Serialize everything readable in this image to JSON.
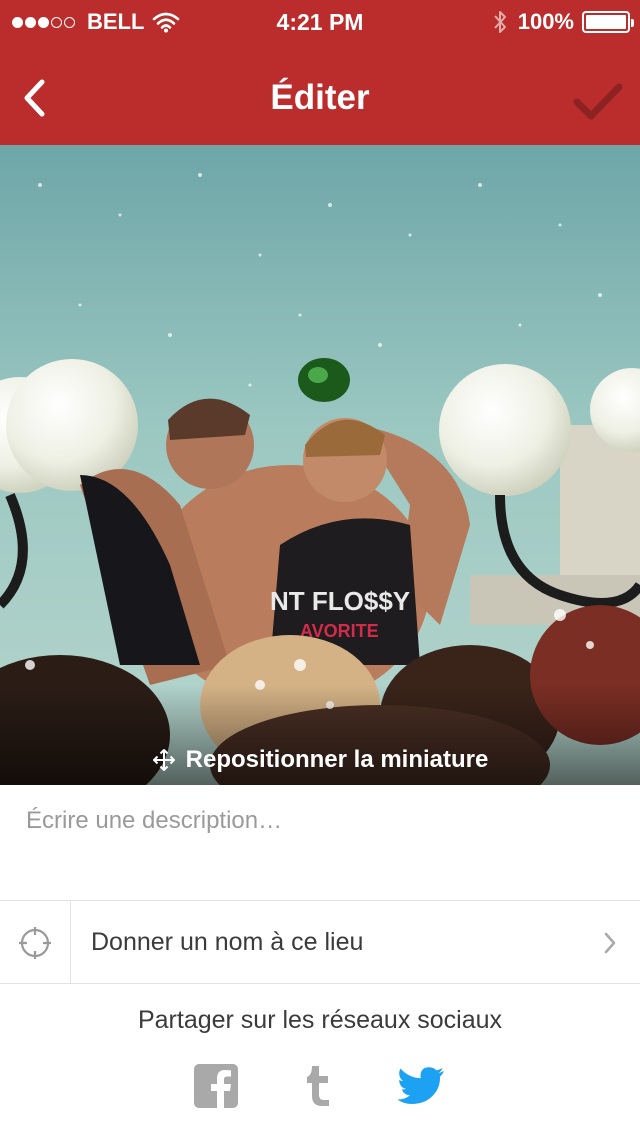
{
  "status_bar": {
    "carrier": "BELL",
    "time": "4:21 PM",
    "battery": "100%",
    "signal_bars_filled": 3,
    "signal_bars_total": 5,
    "battery_level": 1.0
  },
  "nav": {
    "title": "Éditer",
    "back_icon": "chevron-left-icon",
    "confirm_icon": "checkmark-icon"
  },
  "photo": {
    "reposition_label": "Repositionner la miniature",
    "reposition_icon": "move-arrows-icon"
  },
  "description": {
    "placeholder": "Écrire une description…",
    "value": ""
  },
  "location": {
    "label": "Donner un nom à ce lieu",
    "icon": "crosshair-icon"
  },
  "share": {
    "title": "Partager sur les réseaux sociaux",
    "networks": [
      "facebook-icon",
      "tumblr-icon",
      "twitter-icon"
    ]
  },
  "colors": {
    "header": "#bb2d2d",
    "twitter": "#1da1f2",
    "muted_icon": "#a9a9a9"
  }
}
